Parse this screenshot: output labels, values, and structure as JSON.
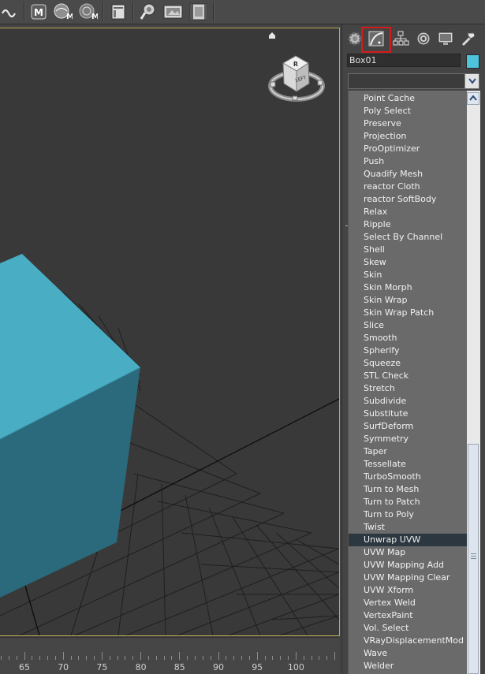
{
  "toolbar": {
    "buttons": [
      {
        "name": "wave-icon"
      },
      {
        "name": "material-editor-icon",
        "label": "M"
      },
      {
        "name": "render-setup-icon",
        "label": "M"
      },
      {
        "name": "rendered-frame-icon",
        "label": "M"
      },
      {
        "name": "render-window-icon"
      },
      {
        "name": "render-production-icon"
      },
      {
        "name": "render-frame-icon"
      },
      {
        "name": "video-post-icon"
      }
    ]
  },
  "viewcube": {
    "face_top": "R",
    "face_left": "LEFT"
  },
  "timeline": {
    "ticks": [
      "65",
      "70",
      "75",
      "80",
      "85",
      "90",
      "95",
      "100"
    ]
  },
  "panel": {
    "tabs": [
      "create-tab",
      "modify-tab",
      "hierarchy-tab",
      "motion-tab",
      "display-tab",
      "utilities-tab"
    ],
    "object_name": "Box01",
    "object_color": "#4dc3dc",
    "modifier_list_value": "",
    "modifiers": [
      "Point Cache",
      "Poly Select",
      "Preserve",
      "Projection",
      "ProOptimizer",
      "Push",
      "Quadify Mesh",
      "reactor Cloth",
      "reactor SoftBody",
      "Relax",
      "Ripple",
      "Select By Channel",
      "Shell",
      "Skew",
      "Skin",
      "Skin Morph",
      "Skin Wrap",
      "Skin Wrap Patch",
      "Slice",
      "Smooth",
      "Spherify",
      "Squeeze",
      "STL Check",
      "Stretch",
      "Subdivide",
      "Substitute",
      "SurfDeform",
      "Symmetry",
      "Taper",
      "Tessellate",
      "TurboSmooth",
      "Turn to Mesh",
      "Turn to Patch",
      "Turn to Poly",
      "Twist",
      "Unwrap UVW",
      "UVW Map",
      "UVW Mapping Add",
      "UVW Mapping Clear",
      "UVW Xform",
      "Vertex Weld",
      "VertexPaint",
      "Vol. Select",
      "VRayDisplacementMod",
      "Wave",
      "Welder"
    ],
    "selected_modifier": "Unwrap UVW"
  },
  "colors": {
    "viewport_bg": "#393939",
    "box_top": "#49aec4",
    "box_side": "#2a6a7c",
    "highlight": "#d41b1b"
  }
}
